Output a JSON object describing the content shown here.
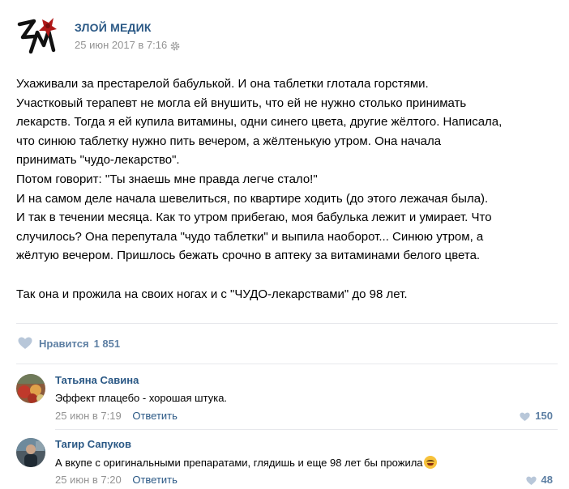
{
  "post": {
    "author": "ЗЛОЙ МЕДИК",
    "date": "25 июн 2017 в 7:16",
    "lines": [
      "Ухаживали за престарелой бабулькой. И она таблетки глотала горстями.",
      "Участковый терапевт не могла ей внушить, что ей не нужно столько принимать",
      "лекарств. Тогда я ей купила витамины, одни синего цвета, другие жёлтого. Написала,",
      "что синюю таблетку нужно пить вечером, а жёлтенькую утром. Она начала",
      "принимать \"чудо-лекарство\".",
      "Потом говорит: \"Ты знаешь мне правда легче стало!\"",
      "И на самом деле начала шевелиться, по квартире ходить (до этого лежачая была).",
      "И так в течении месяца. Как то утром прибегаю, моя бабулька лежит и умирает. Что",
      "случилось? Она перепутала \"чудо таблетки\" и выпила наоборот... Синюю утром, а",
      "жёлтую вечером. Пришлось бежать срочно в аптеку за витаминами белого цвета.",
      "",
      "Так она и прожила на своих ногах и с \"ЧУДО-лекарствами\" до 98 лет."
    ],
    "likes_label": "Нравится",
    "likes_count": "1 851",
    "icons": {
      "logo": "zm-logo-icon",
      "settings": "gear-icon",
      "like": "heart-icon"
    }
  },
  "comments": [
    {
      "author": "Татьяна Савина",
      "text": "Эффект плацебо - хорошая штука.",
      "date": "25 июн в 7:19",
      "reply_label": "Ответить",
      "likes": "150"
    },
    {
      "author": "Тагир Сапуков",
      "text": "А вкупе с оригинальными препаратами, глядишь и еще 98 лет бы прожила",
      "emoji": "laughing-face-emoji",
      "date": "25 июн в 7:20",
      "reply_label": "Ответить",
      "likes": "48"
    }
  ],
  "colors": {
    "link": "#2a5885",
    "muted": "#939393",
    "likes": "#5d7fa3",
    "divider": "#e7e8ec"
  }
}
